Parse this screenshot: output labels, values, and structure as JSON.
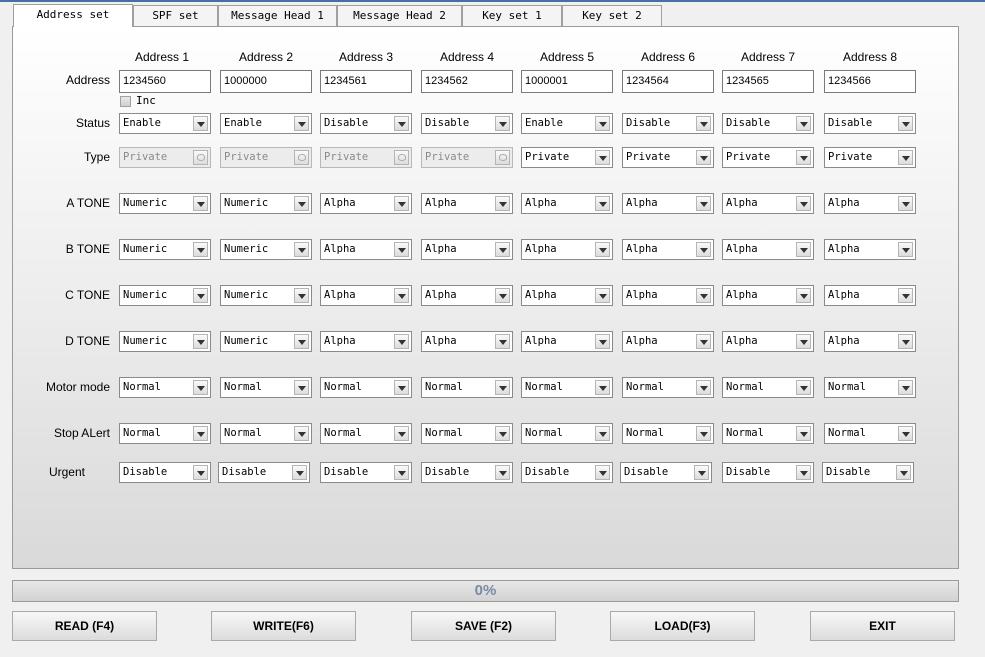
{
  "tabs": [
    "Address set",
    "SPF set",
    "Message Head 1",
    "Message Head 2",
    "Key set 1",
    "Key set 2"
  ],
  "active_tab": 0,
  "columns": [
    "Address 1",
    "Address 2",
    "Address 3",
    "Address 4",
    "Address 5",
    "Address 6",
    "Address 7",
    "Address 8"
  ],
  "address": {
    "label": "Address",
    "values": [
      "1234560",
      "1000000",
      "1234561",
      "1234562",
      "1000001",
      "1234564",
      "1234565",
      "1234566"
    ]
  },
  "inc_label": "Inc",
  "rows": [
    {
      "key": "status",
      "label": "Status",
      "values": [
        "Enable",
        "Enable",
        "Disable",
        "Disable",
        "Enable",
        "Disable",
        "Disable",
        "Disable"
      ],
      "disabled": [
        false,
        false,
        false,
        false,
        false,
        false,
        false,
        false
      ]
    },
    {
      "key": "type",
      "label": "Type",
      "values": [
        "Private",
        "Private",
        "Private",
        "Private",
        "Private",
        "Private",
        "Private",
        "Private"
      ],
      "disabled": [
        true,
        true,
        true,
        true,
        false,
        false,
        false,
        false
      ]
    },
    {
      "key": "a-tone",
      "label": "A TONE",
      "values": [
        "Numeric",
        "Numeric",
        "Alpha",
        "Alpha",
        "Alpha",
        "Alpha",
        "Alpha",
        "Alpha"
      ],
      "disabled": [
        false,
        false,
        false,
        false,
        false,
        false,
        false,
        false
      ]
    },
    {
      "key": "b-tone",
      "label": "B TONE",
      "values": [
        "Numeric",
        "Numeric",
        "Alpha",
        "Alpha",
        "Alpha",
        "Alpha",
        "Alpha",
        "Alpha"
      ],
      "disabled": [
        false,
        false,
        false,
        false,
        false,
        false,
        false,
        false
      ]
    },
    {
      "key": "c-tone",
      "label": "C TONE",
      "values": [
        "Numeric",
        "Numeric",
        "Alpha",
        "Alpha",
        "Alpha",
        "Alpha",
        "Alpha",
        "Alpha"
      ],
      "disabled": [
        false,
        false,
        false,
        false,
        false,
        false,
        false,
        false
      ]
    },
    {
      "key": "d-tone",
      "label": "D TONE",
      "values": [
        "Numeric",
        "Numeric",
        "Alpha",
        "Alpha",
        "Alpha",
        "Alpha",
        "Alpha",
        "Alpha"
      ],
      "disabled": [
        false,
        false,
        false,
        false,
        false,
        false,
        false,
        false
      ]
    },
    {
      "key": "motor-mode",
      "label": "Motor mode",
      "values": [
        "Normal",
        "Normal",
        "Normal",
        "Normal",
        "Normal",
        "Normal",
        "Normal",
        "Normal"
      ],
      "disabled": [
        false,
        false,
        false,
        false,
        false,
        false,
        false,
        false
      ]
    },
    {
      "key": "stop-alert",
      "label": "Stop ALert",
      "values": [
        "Normal",
        "Normal",
        "Normal",
        "Normal",
        "Normal",
        "Normal",
        "Normal",
        "Normal"
      ],
      "disabled": [
        false,
        false,
        false,
        false,
        false,
        false,
        false,
        false
      ]
    },
    {
      "key": "urgent",
      "label": "Urgent",
      "values": [
        "Disable",
        "Disable",
        "Disable",
        "Disable",
        "Disable",
        "Disable",
        "Disable",
        "Disable"
      ],
      "disabled": [
        false,
        false,
        false,
        false,
        false,
        false,
        false,
        false
      ]
    }
  ],
  "progress": {
    "text": "0%",
    "percent": 0
  },
  "buttons": [
    "READ (F4)",
    "WRITE(F6)",
    "SAVE  (F2)",
    "LOAD(F3)",
    "EXIT"
  ]
}
